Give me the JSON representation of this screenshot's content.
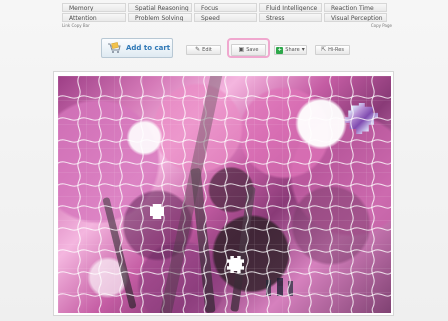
{
  "skills": {
    "row1": [
      "Memory",
      "Spatial Reasoning",
      "Focus",
      "Fluid Intelligence",
      "Reaction Time"
    ],
    "row2": [
      "Attention",
      "Problem Solving",
      "Speed",
      "Stress",
      "Visual Perception"
    ]
  },
  "fine_links": {
    "left": "Link Copy Bar",
    "right": "Copy Page"
  },
  "toolbar": {
    "add_to_cart": "Add to cart",
    "edit": "Edit",
    "save": "Save",
    "share": "Share",
    "hires": "Hi-Res"
  },
  "colors": {
    "cart_text": "#2f78b7",
    "share_green": "#2ea84b",
    "save_highlight": "#f0a8cf"
  },
  "icons": {
    "cart": "shopping-cart-icon",
    "edit": "pencil-icon",
    "save": "save-icon",
    "share": "share-icon",
    "chevron": "chevron-down-icon"
  }
}
